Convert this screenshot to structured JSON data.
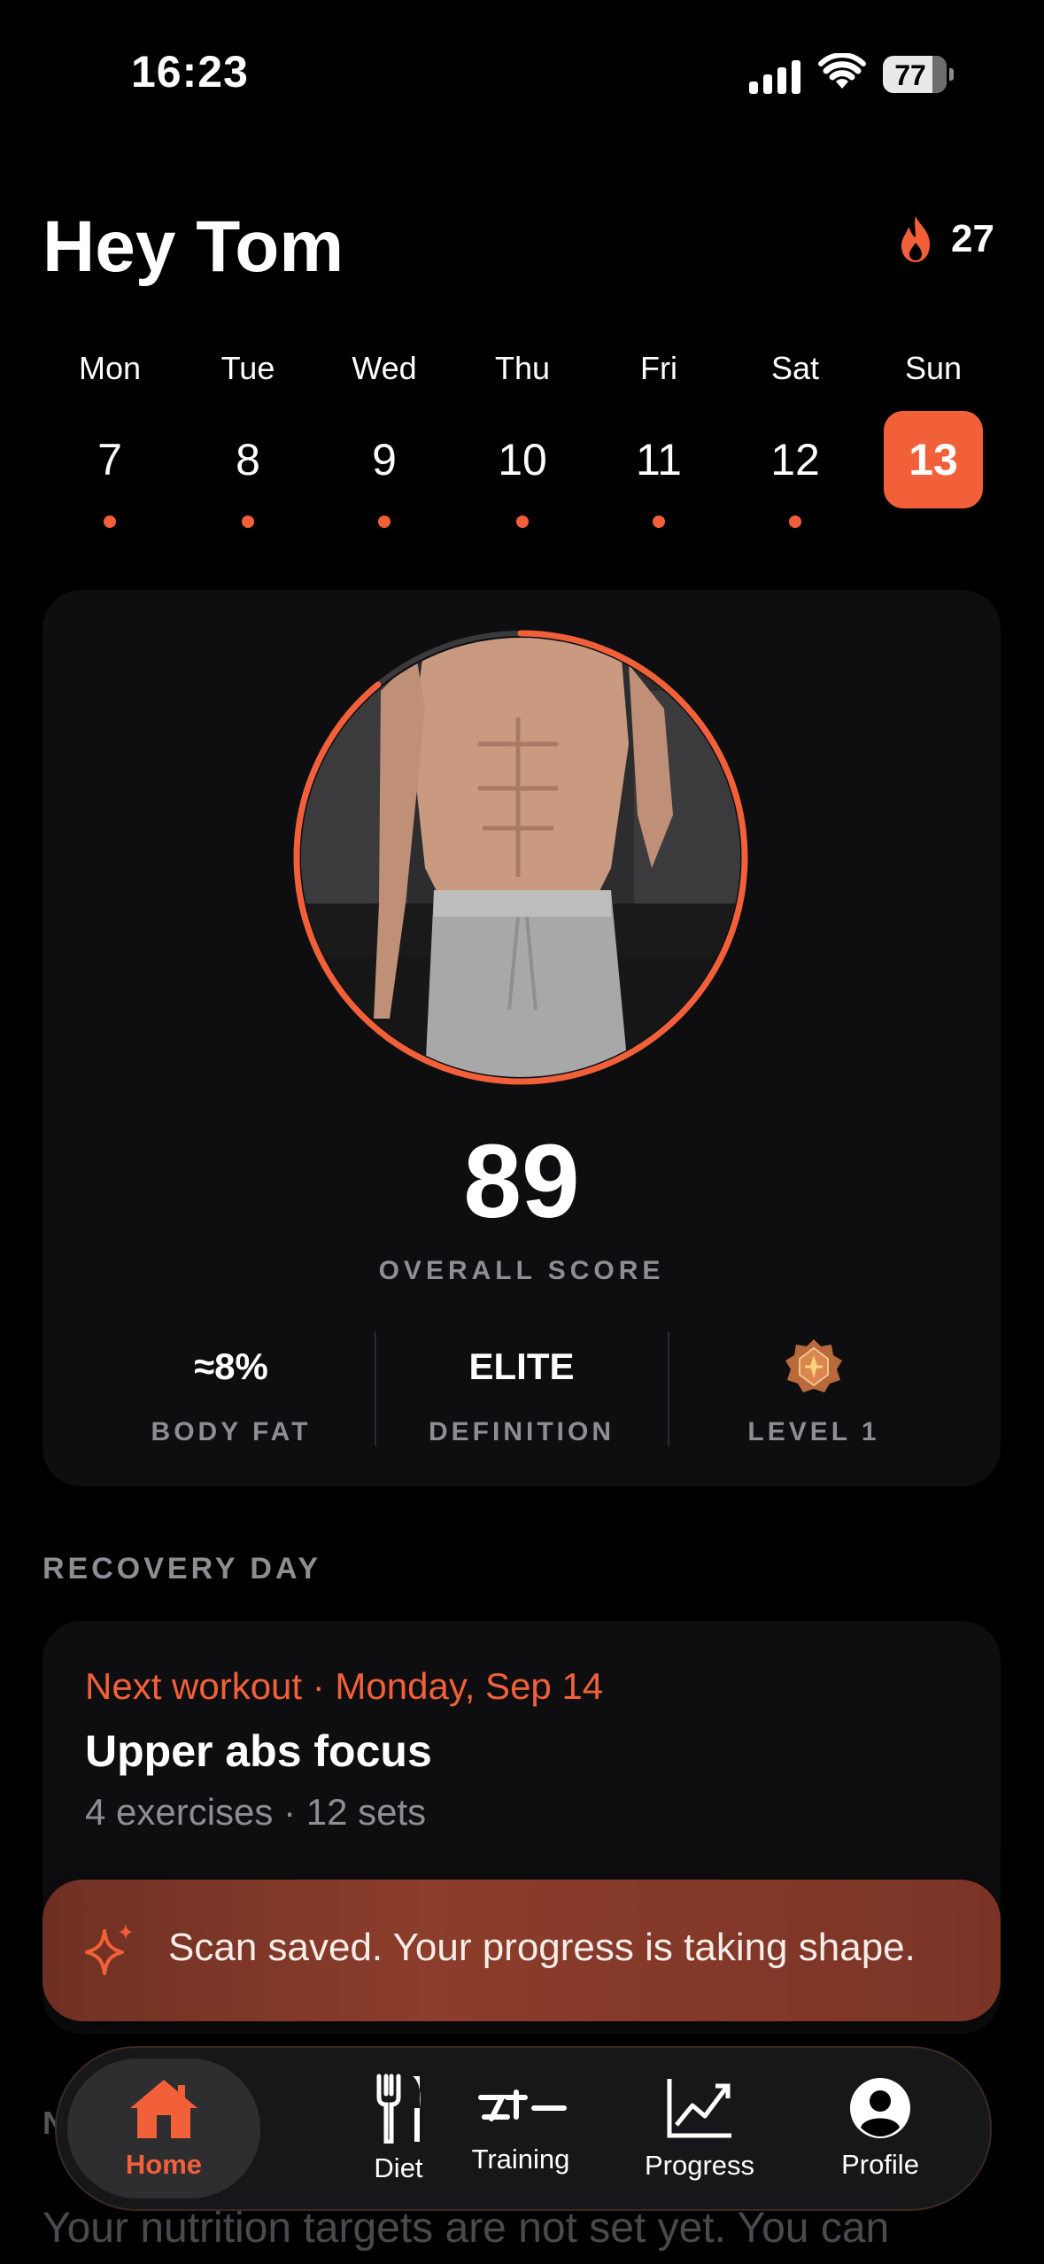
{
  "status_bar": {
    "time": "16:23",
    "battery": "77"
  },
  "header": {
    "greeting": "Hey Tom",
    "streak": "27"
  },
  "week": [
    {
      "name": "Mon",
      "num": "7",
      "dot": true,
      "selected": false
    },
    {
      "name": "Tue",
      "num": "8",
      "dot": true,
      "selected": false
    },
    {
      "name": "Wed",
      "num": "9",
      "dot": true,
      "selected": false
    },
    {
      "name": "Thu",
      "num": "10",
      "dot": true,
      "selected": false
    },
    {
      "name": "Fri",
      "num": "11",
      "dot": true,
      "selected": false
    },
    {
      "name": "Sat",
      "num": "12",
      "dot": true,
      "selected": false
    },
    {
      "name": "Sun",
      "num": "13",
      "dot": false,
      "selected": true
    }
  ],
  "score_card": {
    "score": "89",
    "score_label": "OVERALL SCORE",
    "score_progress": 0.89,
    "stats": {
      "body_fat_value": "≈8%",
      "body_fat_label": "BODY FAT",
      "definition_value": "ELITE",
      "definition_label": "DEFINITION",
      "level_label": "LEVEL 1"
    }
  },
  "recovery": {
    "section_title": "RECOVERY DAY",
    "next_workout": "Next workout · Monday, Sep 14",
    "title": "Upper abs focus",
    "subtitle": "4 exercises · 12 sets"
  },
  "toast": {
    "message": "Scan saved. Your progress is taking shape."
  },
  "behind": {
    "text": "Your nutrition targets are not set yet. You can",
    "heading_initial": "N"
  },
  "tabs": [
    {
      "label": "Home",
      "icon": "home-icon",
      "active": true
    },
    {
      "label": "Diet",
      "icon": "fork-knife-icon",
      "active": false
    },
    {
      "label": "Training",
      "icon": "training-icon",
      "active": false
    },
    {
      "label": "Progress",
      "icon": "chart-line-icon",
      "active": false
    },
    {
      "label": "Profile",
      "icon": "profile-icon",
      "active": false
    }
  ],
  "colors": {
    "accent": "#f2603a",
    "card": "#0e0e10",
    "muted": "#8d8d93"
  }
}
